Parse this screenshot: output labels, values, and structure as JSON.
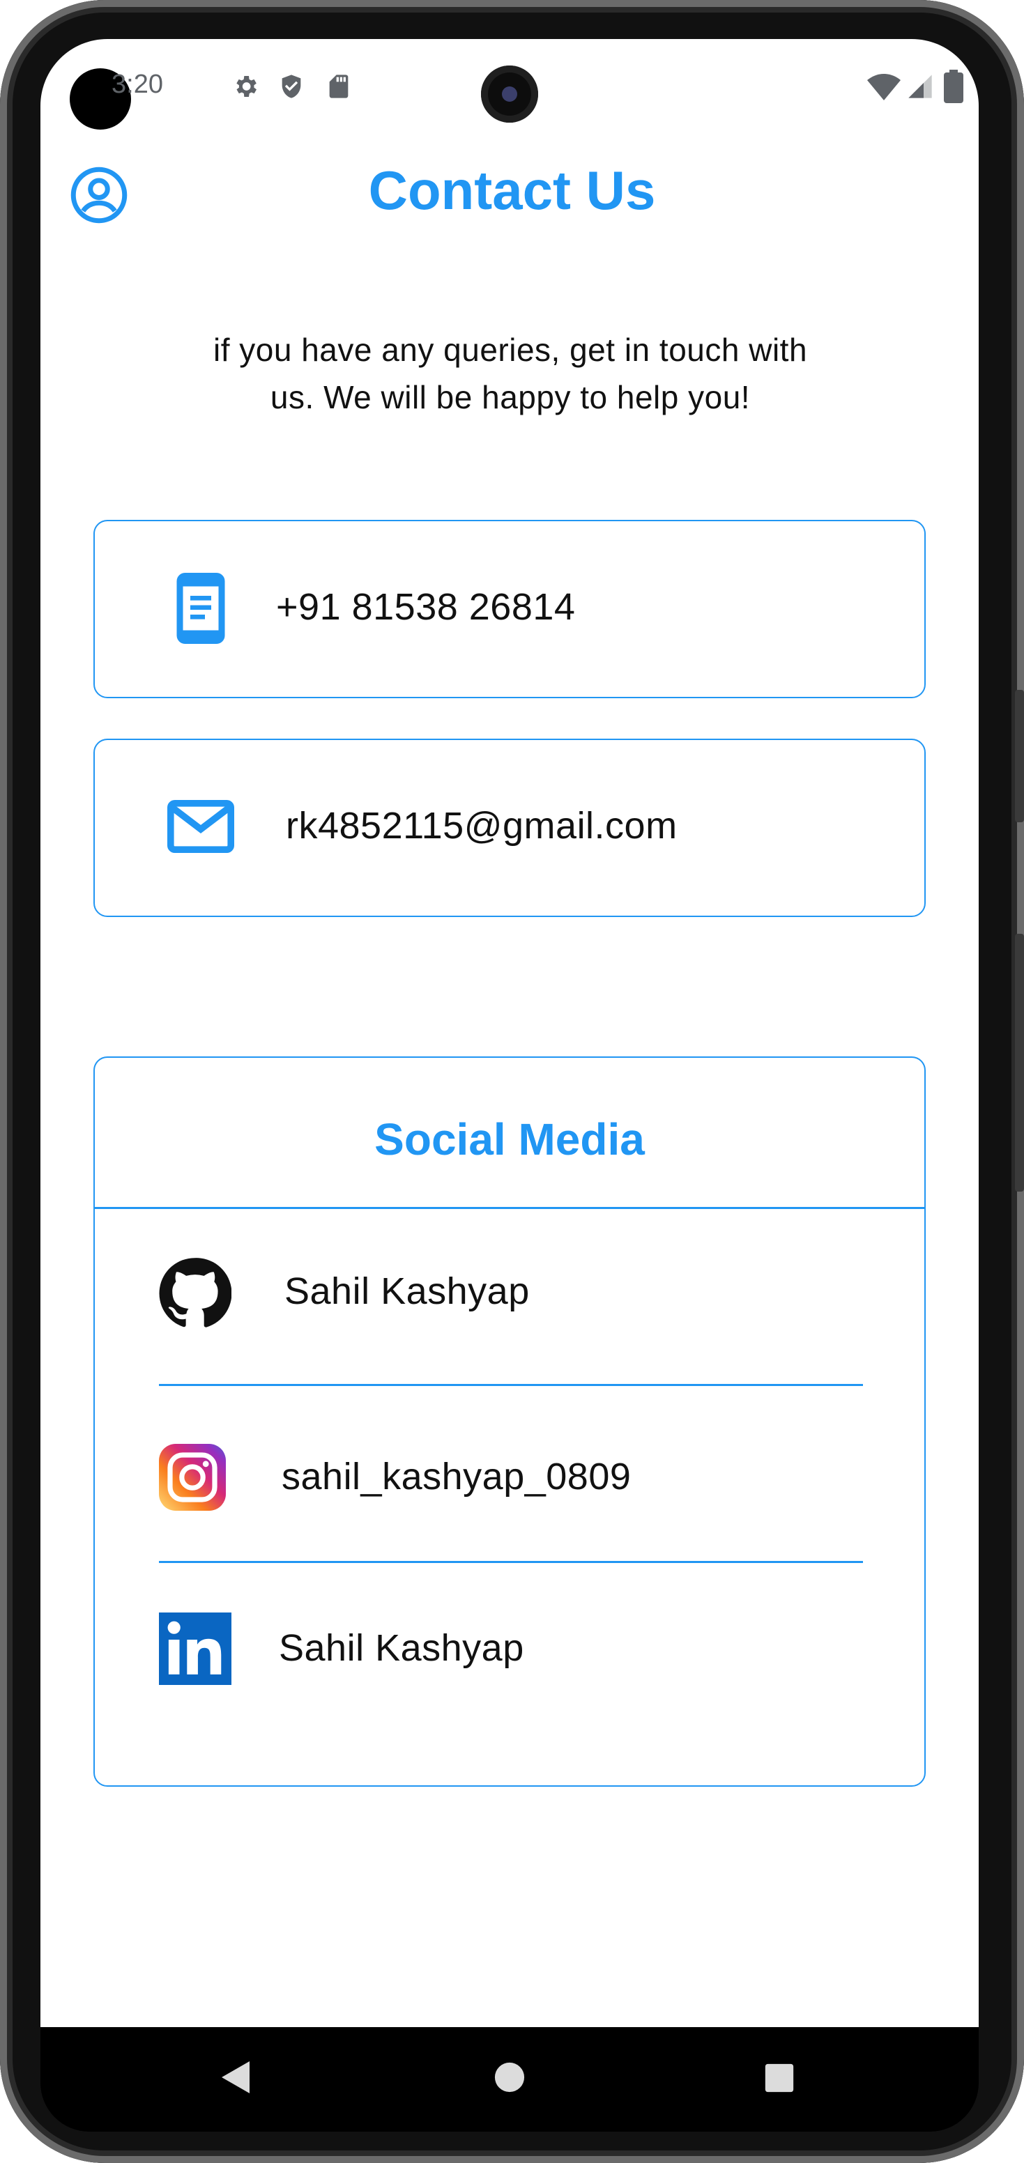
{
  "status_bar": {
    "time": "3:20"
  },
  "header": {
    "title": "Contact Us"
  },
  "intro": {
    "line1": "if you have any queries, get in touch with",
    "line2": "us. We will be happy to help you!"
  },
  "contact": {
    "phone": "+91 81538 26814",
    "email": "rk4852115@gmail.com"
  },
  "social": {
    "title": "Social Media",
    "items": [
      {
        "platform": "github",
        "handle": "Sahil Kashyap"
      },
      {
        "platform": "instagram",
        "handle": "sahil_kashyap_0809"
      },
      {
        "platform": "linkedin",
        "handle": "Sahil Kashyap"
      }
    ]
  },
  "colors": {
    "accent": "#2196F3",
    "text": "#111111",
    "linkedin": "#0A66C2"
  }
}
